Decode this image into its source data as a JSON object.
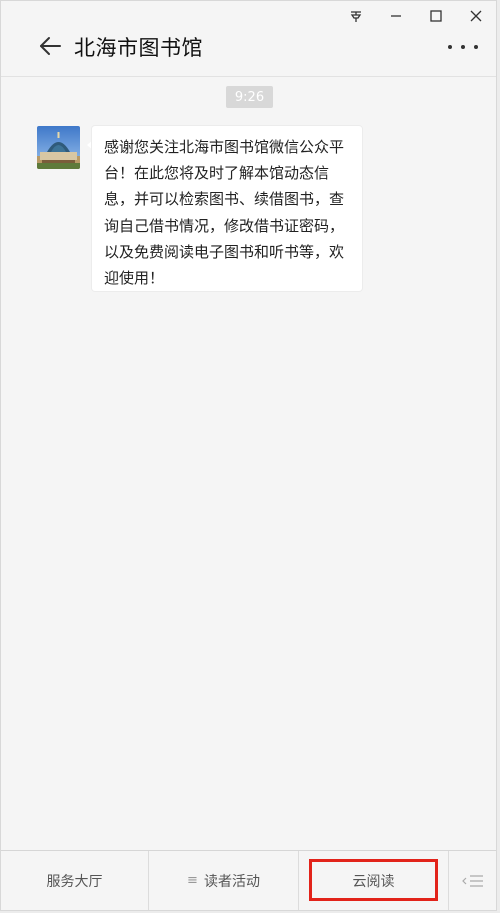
{
  "window": {
    "pin_icon": "pin-icon",
    "minimize_icon": "minimize-icon",
    "maximize_icon": "maximize-icon",
    "close_icon": "close-icon"
  },
  "header": {
    "title": "北海市图书馆",
    "back_icon": "arrow-left-icon",
    "more_icon": "ellipsis-icon"
  },
  "chat": {
    "time": "9:26",
    "message": "感谢您关注北海市图书馆微信公众平台！在此您将及时了解本馆动态信息，并可以检索图书、续借图书，查询自己借书情况，修改借书证密码，以及免费阅读电子图书和听书等，欢迎使用！"
  },
  "menu": {
    "items": [
      {
        "label": "服务大厅"
      },
      {
        "prefix": "≡",
        "label": "读者活动"
      },
      {
        "label": "云阅读"
      }
    ],
    "switch_icon": "keyboard-switch-icon"
  },
  "colors": {
    "highlight": "#e2231a",
    "background": "#f5f5f5",
    "bubble": "#ffffff"
  }
}
